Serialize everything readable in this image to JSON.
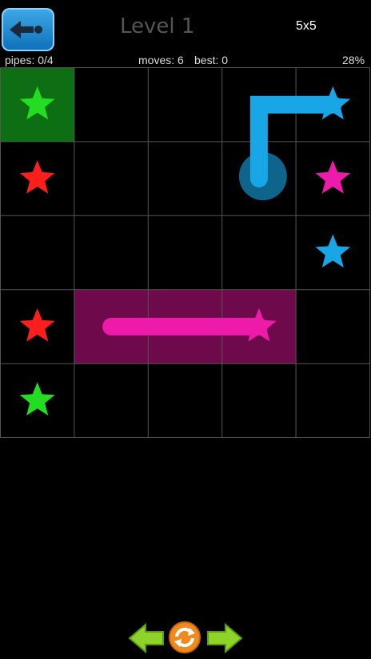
{
  "header": {
    "title": "Level 1",
    "board_size": "5x5"
  },
  "status": {
    "pipes": "pipes: 0/4",
    "moves": "moves: 6",
    "best": "best: 0",
    "progress": "28%"
  },
  "board": {
    "rows": 5,
    "cols": 5,
    "colors": {
      "green": "#22dd22",
      "red": "#ff1e1e",
      "blue": "#18a6e6",
      "magenta": "#ee1aa9"
    },
    "endpoints": [
      {
        "row": 0,
        "col": 0,
        "color": "green"
      },
      {
        "row": 4,
        "col": 0,
        "color": "green"
      },
      {
        "row": 1,
        "col": 0,
        "color": "red"
      },
      {
        "row": 3,
        "col": 0,
        "color": "red"
      },
      {
        "row": 0,
        "col": 4,
        "color": "blue"
      },
      {
        "row": 2,
        "col": 4,
        "color": "blue"
      },
      {
        "row": 1,
        "col": 4,
        "color": "magenta"
      },
      {
        "row": 3,
        "col": 3,
        "color": "magenta"
      }
    ],
    "highlighted_cells": [
      {
        "row": 0,
        "col": 0,
        "color": "green"
      },
      {
        "row": 3,
        "col": 1,
        "color": "magenta"
      },
      {
        "row": 3,
        "col": 2,
        "color": "magenta"
      },
      {
        "row": 3,
        "col": 3,
        "color": "magenta"
      }
    ],
    "paths": [
      {
        "color": "blue",
        "cells": [
          [
            0,
            4
          ],
          [
            0,
            3
          ],
          [
            1,
            3
          ]
        ]
      },
      {
        "color": "magenta",
        "cells": [
          [
            3,
            1
          ],
          [
            3,
            2
          ],
          [
            3,
            3
          ]
        ]
      }
    ]
  },
  "controls": {
    "prev": "left-arrow-icon",
    "reset": "reset-icon",
    "next": "right-arrow-icon"
  }
}
